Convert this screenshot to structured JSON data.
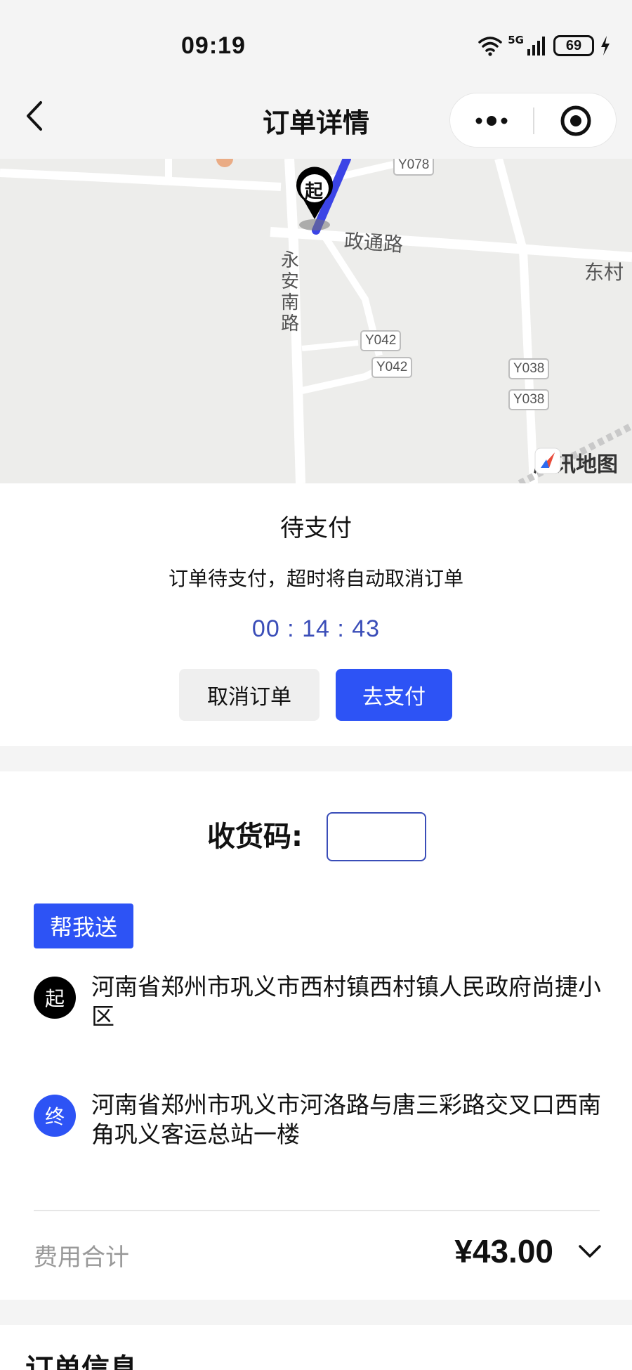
{
  "status_bar": {
    "time": "09:19",
    "network": "5G",
    "battery": "69"
  },
  "nav": {
    "title": "订单详情",
    "icons": {
      "back": "chevron-left-icon",
      "more": "more-dots-icon",
      "close": "target-close-icon"
    }
  },
  "map": {
    "roads": [
      {
        "name": "政通路"
      },
      {
        "name": "永安南路"
      }
    ],
    "village": "东村",
    "badges": [
      "Y078",
      "Y042",
      "Y042",
      "Y038",
      "Y038"
    ],
    "start_marker": "起",
    "logo_text": "腾讯地图",
    "route_color": "#3b44e6"
  },
  "order_status": {
    "title": "待支付",
    "description": "订单待支付，超时将自动取消订单",
    "countdown": "00 : 14 : 43",
    "cancel_label": "取消订单",
    "pay_label": "去支付"
  },
  "delivery": {
    "code_label": "收货码:",
    "code_value": "",
    "service_tag": "帮我送",
    "start": {
      "icon_label": "起",
      "address": "河南省郑州市巩义市西村镇西村镇人民政府尚捷小区"
    },
    "end": {
      "icon_label": "终",
      "address": "河南省郑州市巩义市河洛路与唐三彩路交叉口西南角巩义客运总站一楼"
    },
    "fee_label": "费用合计",
    "fee_value": "¥43.00"
  },
  "order_info": {
    "title": "订单信息"
  },
  "colors": {
    "accent": "#2d53f5",
    "countdown": "#3a4db8",
    "map_bg": "#ededeb"
  }
}
